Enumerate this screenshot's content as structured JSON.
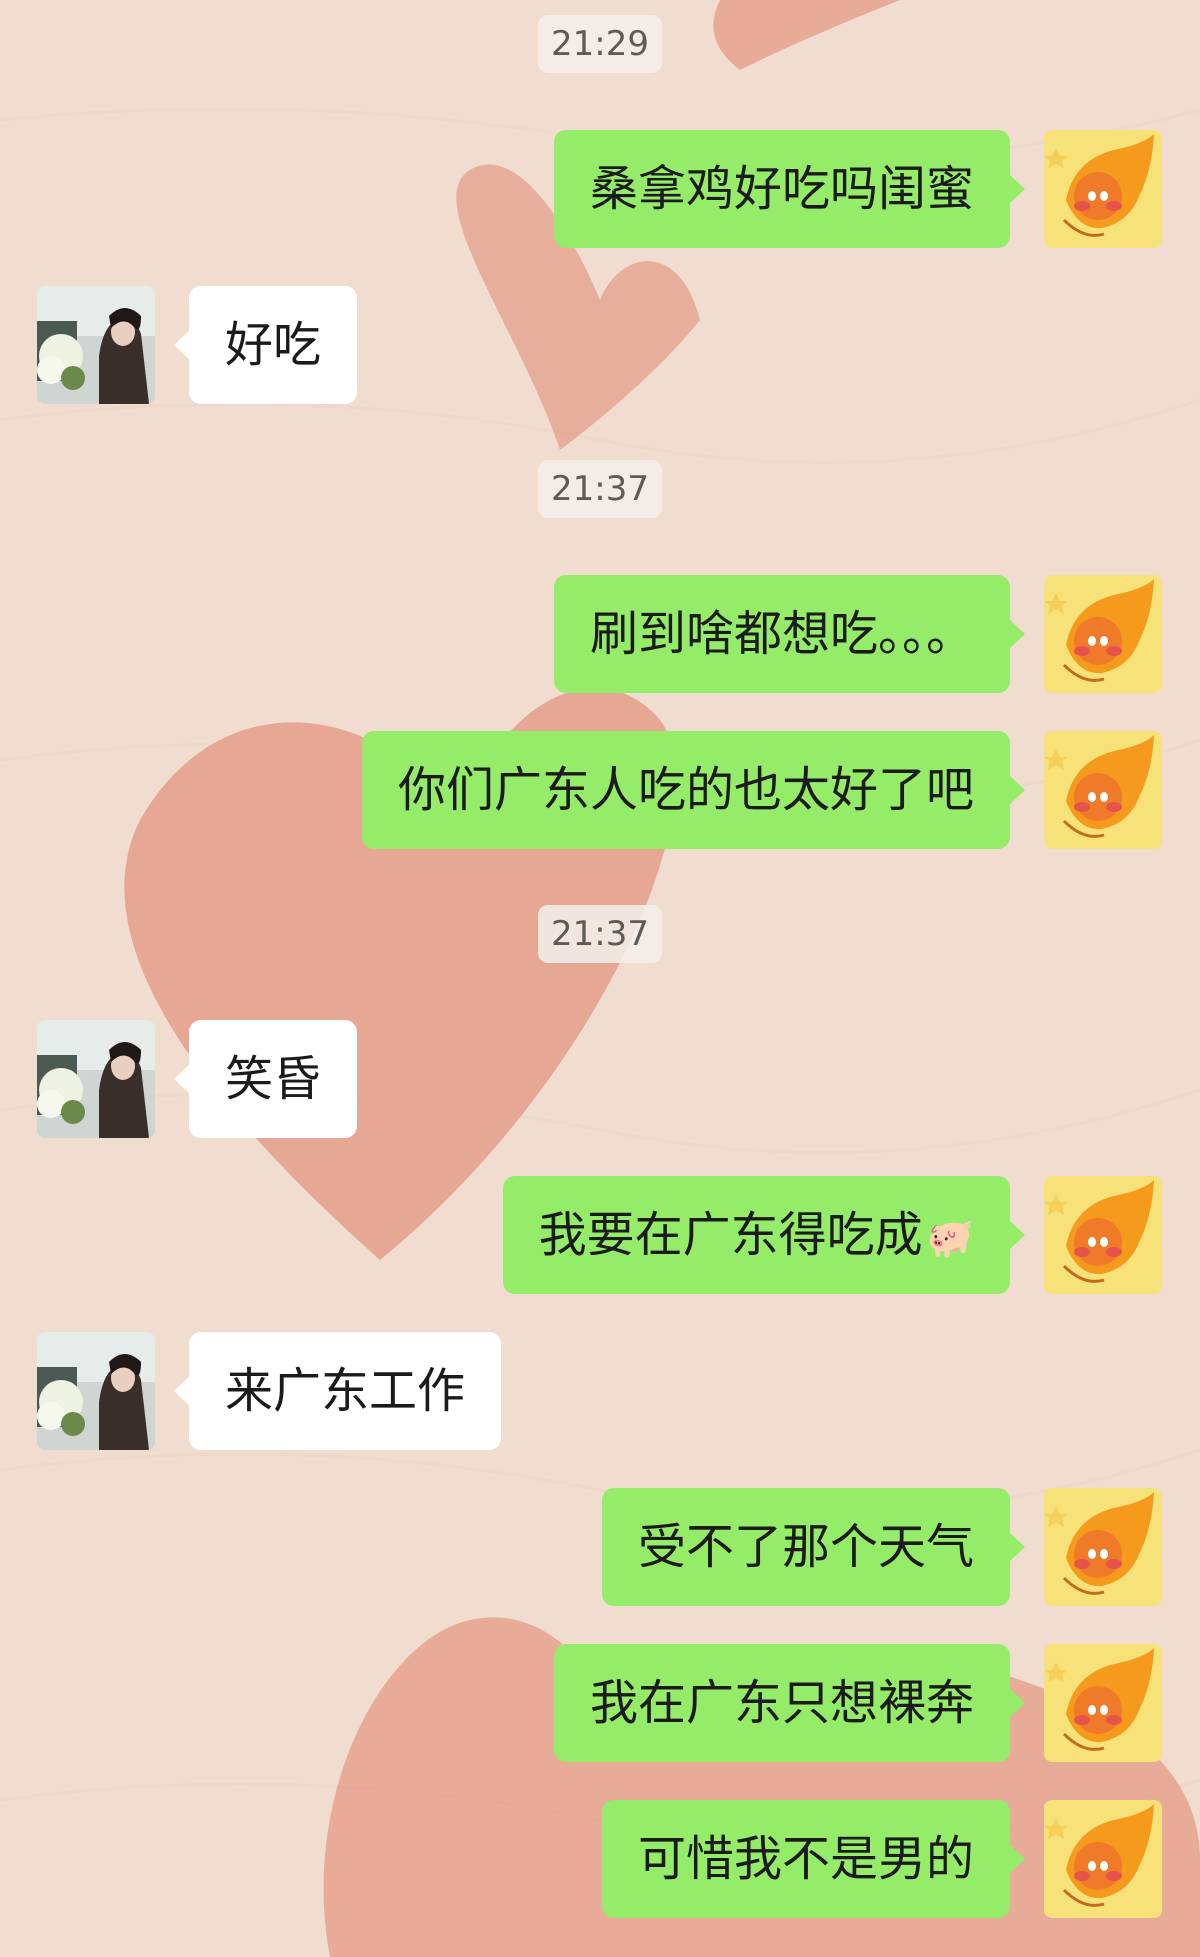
{
  "chat": {
    "messages": [
      {
        "type": "time",
        "text": "21:29"
      },
      {
        "type": "msg",
        "sender": "me",
        "text": "桑拿鸡好吃吗闺蜜"
      },
      {
        "type": "msg",
        "sender": "other",
        "text": "好吃"
      },
      {
        "type": "time",
        "text": "21:37"
      },
      {
        "type": "msg",
        "sender": "me",
        "text": "刷到啥都想吃。。。"
      },
      {
        "type": "msg",
        "sender": "me",
        "text": "你们广东人吃的也太好了吧"
      },
      {
        "type": "time",
        "text": "21:37"
      },
      {
        "type": "msg",
        "sender": "other",
        "text": "笑昏"
      },
      {
        "type": "msg",
        "sender": "me",
        "text": "我要在广东得吃成",
        "emoji": "🐖"
      },
      {
        "type": "msg",
        "sender": "other",
        "text": "来广东工作"
      },
      {
        "type": "msg",
        "sender": "me",
        "text": "受不了那个天气"
      },
      {
        "type": "msg",
        "sender": "me",
        "text": "我在广东只想裸奔"
      },
      {
        "type": "msg",
        "sender": "me",
        "text": "可惜我不是男的"
      }
    ]
  },
  "colors": {
    "background": "#f1ddcf",
    "heart": "#e39a86",
    "my_bubble": "#95ec69",
    "their_bubble": "#ffffff",
    "timestamp_bg": "#f2eeeb"
  },
  "icons": {
    "my_avatar": "cartoon-orange-character-avatar",
    "their_avatar": "photo-girl-with-flowers-avatar"
  }
}
